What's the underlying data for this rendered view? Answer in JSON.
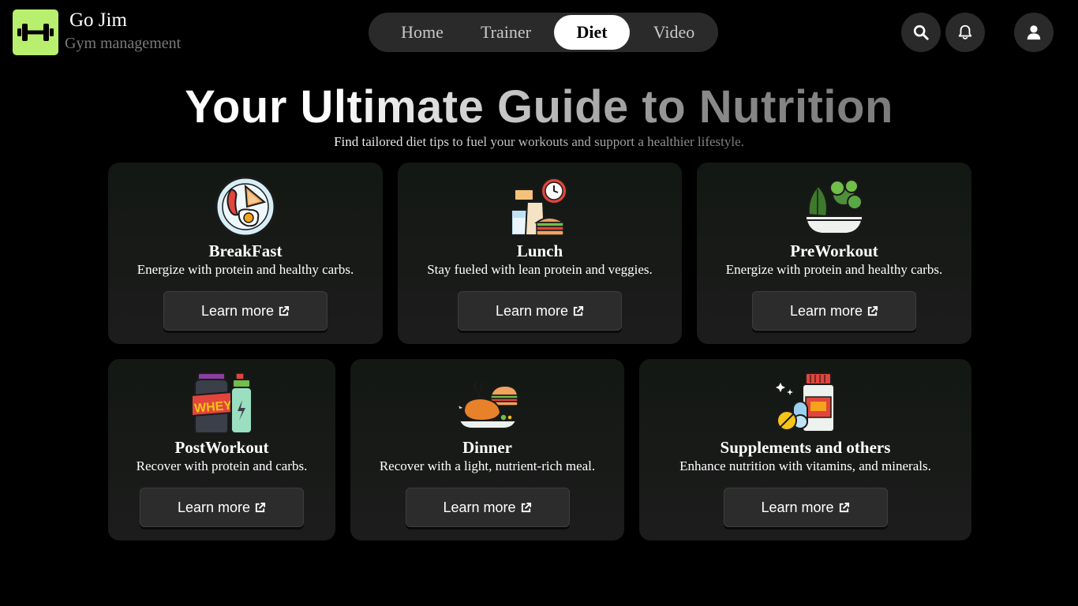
{
  "brand": {
    "name": "Go Jim",
    "subtitle": "Gym management"
  },
  "nav": {
    "items": [
      "Home",
      "Trainer",
      "Diet",
      "Video"
    ],
    "active": "Diet"
  },
  "header_icons": [
    "search-icon",
    "bell-icon",
    "user-icon"
  ],
  "hero": {
    "title": "Your Ultimate Guide to Nutrition",
    "subtitle": "Find tailored diet tips to fuel your workouts and support a healthier lifestyle."
  },
  "cards": [
    {
      "icon": "breakfast-plate-icon",
      "title": "BreakFast",
      "description": "Energize with protein and healthy carbs.",
      "button": "Learn more"
    },
    {
      "icon": "lunch-meal-icon",
      "title": "Lunch",
      "description": "Stay fueled with lean protein and veggies.",
      "button": "Learn more"
    },
    {
      "icon": "salad-bowl-icon",
      "title": "PreWorkout",
      "description": "Energize with protein and healthy carbs.",
      "button": "Learn more"
    },
    {
      "icon": "whey-protein-icon",
      "title": "PostWorkout",
      "description": "Recover with protein and carbs.",
      "button": "Learn more"
    },
    {
      "icon": "roast-chicken-icon",
      "title": "Dinner",
      "description": "Recover with a light, nutrient-rich meal.",
      "button": "Learn more"
    },
    {
      "icon": "supplements-icon",
      "title": "Supplements and others",
      "description": "Enhance nutrition with vitamins, and minerals.",
      "button": "Learn more"
    }
  ],
  "colors": {
    "accent": "#b8ef6e",
    "background": "#000000",
    "card": "#1a1c1a",
    "nav": "#2a2a2a"
  }
}
